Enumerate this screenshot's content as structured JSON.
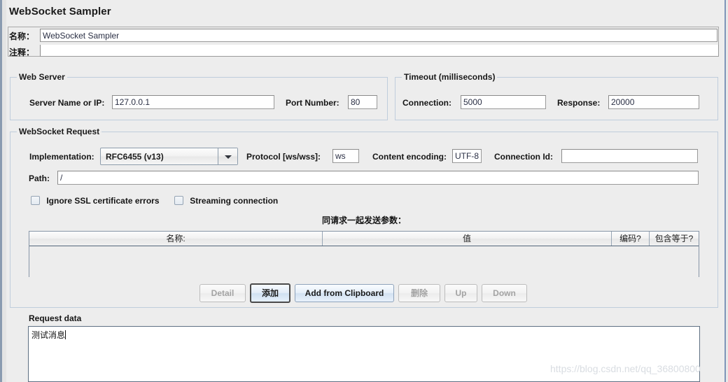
{
  "window": {
    "title": "WebSocket Sampler"
  },
  "form": {
    "name_label": "名称：",
    "name_value": "WebSocket Sampler",
    "comment_label": "注释：",
    "comment_value": ""
  },
  "web_server": {
    "legend": "Web Server",
    "server_name_label": "Server Name or IP:",
    "server_name_value": "127.0.0.1",
    "port_label": "Port Number:",
    "port_value": "80"
  },
  "timeout": {
    "legend": "Timeout (milliseconds)",
    "connection_label": "Connection:",
    "connection_value": "5000",
    "response_label": "Response:",
    "response_value": "20000"
  },
  "websocket_request": {
    "legend": "WebSocket Request",
    "implementation_label": "Implementation:",
    "implementation_value": "RFC6455 (v13)",
    "protocol_label": "Protocol [ws/wss]:",
    "protocol_value": "ws",
    "content_encoding_label": "Content encoding:",
    "content_encoding_value": "UTF-8",
    "connection_id_label": "Connection Id:",
    "connection_id_value": "",
    "path_label": "Path:",
    "path_value": "/",
    "ignore_ssl_label": "Ignore SSL certificate errors",
    "ignore_ssl_checked": false,
    "streaming_label": "Streaming connection",
    "streaming_checked": false
  },
  "parameters": {
    "title": "同请求一起发送参数：",
    "columns": [
      "名称:",
      "值",
      "编码?",
      "包含等于?"
    ],
    "rows": [],
    "buttons": [
      {
        "label": "Detail",
        "enabled": false
      },
      {
        "label": "添加",
        "enabled": true
      },
      {
        "label": "Add from Clipboard",
        "enabled": true
      },
      {
        "label": "删除",
        "enabled": false
      },
      {
        "label": "Up",
        "enabled": false
      },
      {
        "label": "Down",
        "enabled": false
      }
    ]
  },
  "request_data": {
    "label": "Request data",
    "value": "测试消息"
  },
  "watermark": {
    "text": "https://blog.csdn.net/qq_36800800"
  },
  "colors": {
    "background": "#ededed",
    "group_border": "#bfcddc",
    "field_text": "#2a2f44",
    "panel_edge": "#8a9bb0"
  }
}
